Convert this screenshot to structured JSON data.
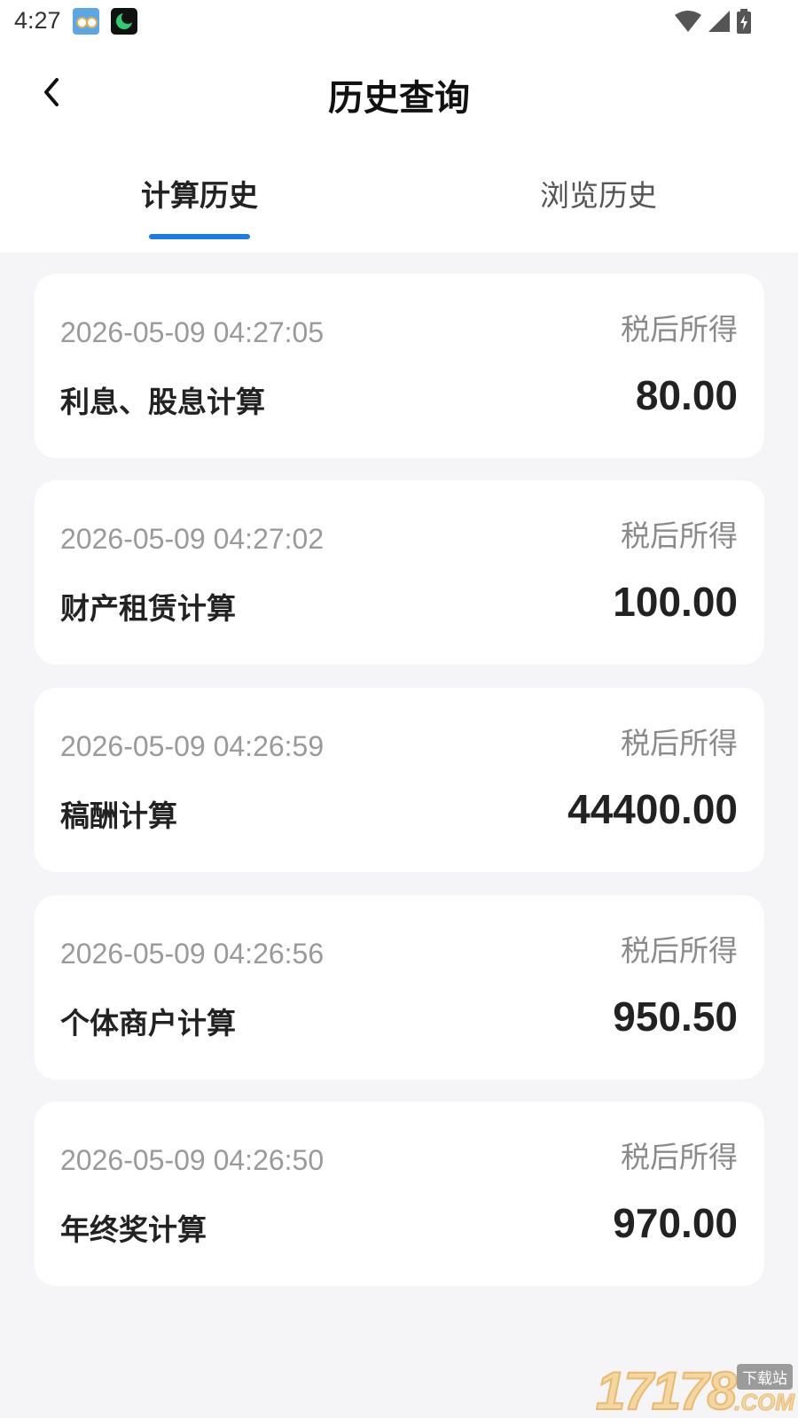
{
  "status_bar": {
    "time": "4:27",
    "icons": [
      "app-owl-icon",
      "app-moon-icon",
      "wifi-icon",
      "signal-icon",
      "battery-charging-icon"
    ]
  },
  "header": {
    "title": "历史查询",
    "back_icon": "chevron-left-icon"
  },
  "tabs": [
    {
      "label": "计算历史",
      "active": true
    },
    {
      "label": "浏览历史",
      "active": false
    }
  ],
  "records": [
    {
      "time": "2026-05-09 04:27:05",
      "type": "利息、股息计算",
      "label": "税后所得",
      "amount": "80.00"
    },
    {
      "time": "2026-05-09 04:27:02",
      "type": "财产租赁计算",
      "label": "税后所得",
      "amount": "100.00"
    },
    {
      "time": "2026-05-09 04:26:59",
      "type": "稿酬计算",
      "label": "税后所得",
      "amount": "44400.00"
    },
    {
      "time": "2026-05-09 04:26:56",
      "type": "个体商户计算",
      "label": "税后所得",
      "amount": "950.50"
    },
    {
      "time": "2026-05-09 04:26:50",
      "type": "年终奖计算",
      "label": "税后所得",
      "amount": "970.00"
    }
  ],
  "watermark": {
    "number": "17178",
    "tag": "下载站",
    "suffix": ".COM"
  },
  "colors": {
    "accent": "#1e7be6",
    "background": "#f5f5f7",
    "card": "#ffffff"
  }
}
